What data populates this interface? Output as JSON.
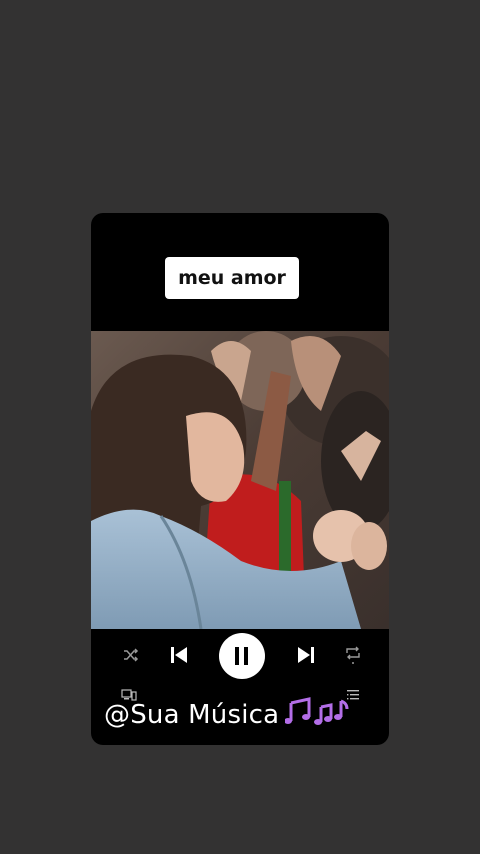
{
  "lyric": {
    "text": "meu amor"
  },
  "player": {
    "icons": {
      "shuffle": "shuffle-icon",
      "previous": "skip-previous-icon",
      "pause": "pause-icon",
      "next": "skip-next-icon",
      "repeat": "repeat-icon",
      "devices": "devices-icon",
      "queue": "queue-icon"
    }
  },
  "watermark": {
    "text": "@Sua Música",
    "icon": "music-notes-icon"
  },
  "colors": {
    "background": "#333232",
    "card": "#000000",
    "accent_notes": "#b36ee8",
    "button_white": "#ffffff"
  }
}
